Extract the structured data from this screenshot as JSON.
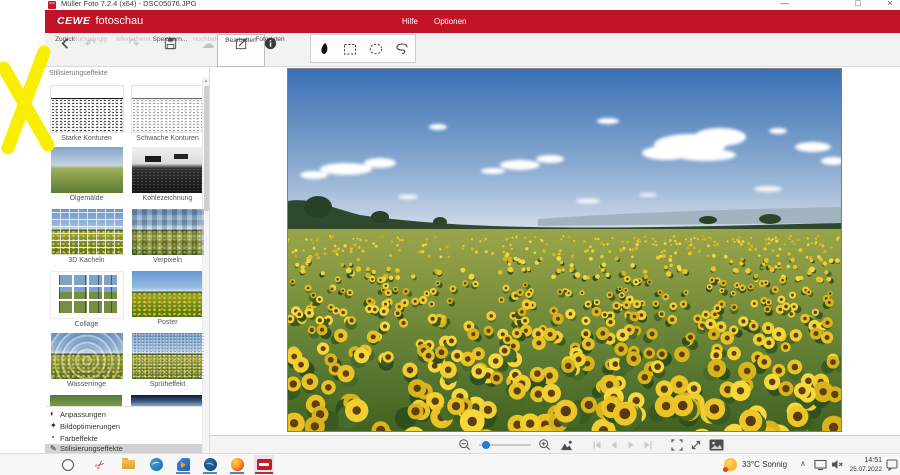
{
  "app": {
    "titlebar": {
      "title": "Müller Foto 7.2.4 (x64) - DSC05076.JPG",
      "minimize": "—",
      "maximize": "□",
      "close": "×"
    },
    "menubar": {
      "brand": "CEWE",
      "product": "fotoschau",
      "help": "Hilfe",
      "options": "Optionen"
    },
    "toolbar": {
      "buttons": [
        {
          "label": "Zurück",
          "icon": "back-chevron",
          "enabled": true
        },
        {
          "label": "Rückgängig",
          "icon": "undo-arrow",
          "enabled": false
        },
        {
          "label": "Wiederherst.",
          "icon": "redo-arrow",
          "enabled": false
        },
        {
          "label": "Speichern...",
          "icon": "save-disk",
          "enabled": true
        },
        {
          "label": "Hochladen",
          "icon": "upload-cloud",
          "enabled": false
        },
        {
          "label": "Bearbeiten",
          "icon": "edit-pencil",
          "enabled": true,
          "active": true
        },
        {
          "label": "Fotodaten",
          "icon": "info-circle",
          "enabled": true
        }
      ],
      "selection_tools": [
        "freehand-mask",
        "rectangle-selection",
        "ellipse-selection",
        "lasso-selection"
      ]
    },
    "sidebar": {
      "header": "Stilisierungseffekte",
      "effects": [
        {
          "label": "Starke Konturen"
        },
        {
          "label": "Schwache Konturen"
        },
        {
          "label": "Ölgemälde"
        },
        {
          "label": "Kohlezeichnung"
        },
        {
          "label": "3D Kacheln"
        },
        {
          "label": "Verpixeln"
        },
        {
          "label": "Collage"
        },
        {
          "label": "Poster"
        },
        {
          "label": "Wasserringe"
        },
        {
          "label": "Sprüheffekt"
        }
      ],
      "categories": [
        {
          "label": "Anpassungen",
          "icon": "half-circle",
          "selected": false
        },
        {
          "label": "Bildoptimierungen",
          "icon": "sparkle-wand",
          "selected": false
        },
        {
          "label": "Farbeffekte",
          "icon": "color-circle",
          "selected": false
        },
        {
          "label": "Stilisierungseffekte",
          "icon": "stylize-pen",
          "selected": true
        }
      ]
    },
    "photo": {
      "description": "Sunflower field under blue sky with scattered clouds and wooded hills at the horizon"
    }
  },
  "taskbar": {
    "pinned": [
      "cortana",
      "snipping-tool",
      "file-explorer",
      "blue-wave-app",
      "media-player",
      "thunderbird",
      "firefox",
      "cewe-foto"
    ],
    "weather": {
      "temperature": "33°C",
      "condition": "Sonnig"
    },
    "tray_expand": "∧",
    "clock": {
      "time": "14:51",
      "date": "25.07.2022"
    }
  },
  "annotation": {
    "type": "yellow-x-marker",
    "color": "#f8ef00"
  },
  "colors": {
    "brand_red": "#c11226",
    "taskbar_underline": "#4a86c8",
    "selected_row": "#d2d2d2",
    "slider_knob": "#1c7fd6"
  }
}
